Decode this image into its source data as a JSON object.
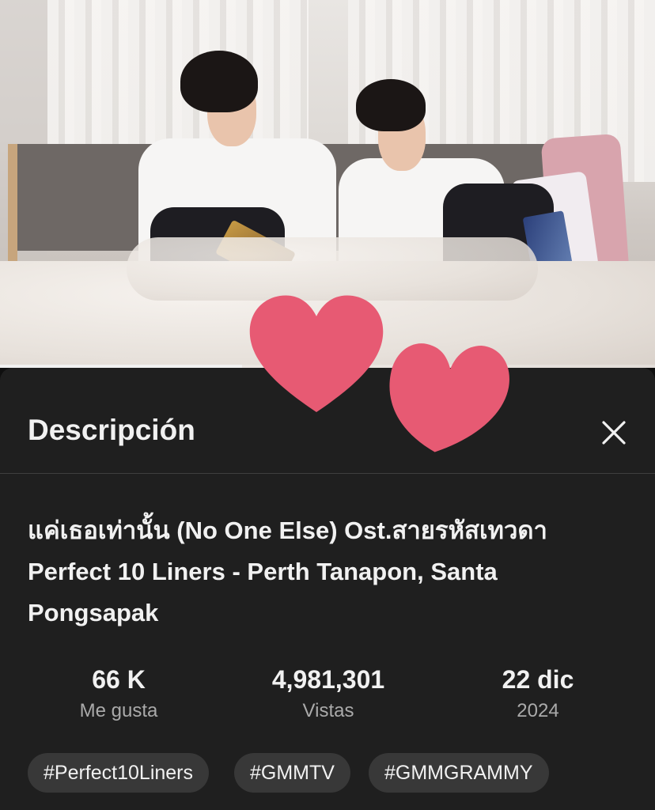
{
  "panel": {
    "title": "Descripción",
    "close_icon": "close-icon"
  },
  "video": {
    "title": "แค่เธอเท่านั้น (No One Else) Ost.สายรหัสเทวดา Perfect 10 Liners - Perth Tanapon, Santa Pongsapak",
    "progress_fraction": 0.37
  },
  "stats": [
    {
      "value": "66 K",
      "label": "Me gusta"
    },
    {
      "value": "4,981,301",
      "label": "Vistas"
    },
    {
      "value": "22 dic",
      "label": "2024"
    }
  ],
  "tags": [
    "#Perfect10Liners",
    "#GMMTV",
    "#GMMGRAMMY"
  ],
  "colors": {
    "heart": "#e75a73",
    "panel_bg": "#1f1f1f",
    "chip_bg": "#383838"
  }
}
